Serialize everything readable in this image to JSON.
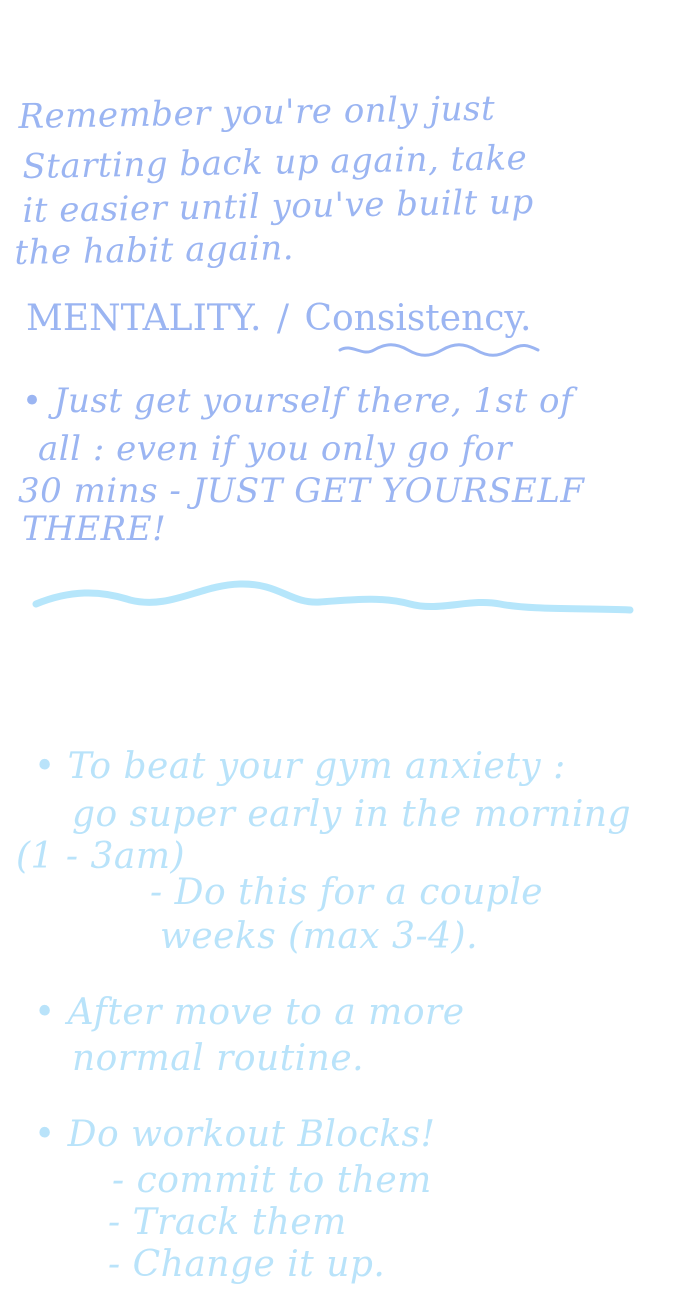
{
  "note_top": {
    "line1": "Remember you're only just",
    "line2": "Starting back up again, take",
    "line3": "it easier until you've built up",
    "line4": "the habit again.",
    "heading_left": "MENTALITY.",
    "heading_divider": "/",
    "heading_right": "Consistency.",
    "bullet1_line1": "• Just get yourself there, 1st of",
    "bullet1_line2": "all : even if you only go for",
    "bullet1_line3": "30 mins - JUST GET YOURSELF",
    "bullet1_line4": "THERE!"
  },
  "note_bottom": {
    "bullet1_line1": "• To beat your gym anxiety :",
    "bullet1_line2": "go super early in the morning",
    "bullet1_line3": "(1 - 3am)",
    "bullet1_sub1": "- Do this for a couple",
    "bullet1_sub2": "weeks (max 3-4).",
    "bullet2_line1": "• After move to a more",
    "bullet2_line2": "normal routine.",
    "bullet3_line1": "• Do workout Blocks!",
    "bullet3_sub1": "- commit to them",
    "bullet3_sub2": "- Track them",
    "bullet3_sub3": "- Change it up."
  },
  "colors": {
    "ink_top": "#9bb5f2",
    "ink_bottom": "#b9e3fa",
    "divider_wave": "#b6e6fb"
  }
}
